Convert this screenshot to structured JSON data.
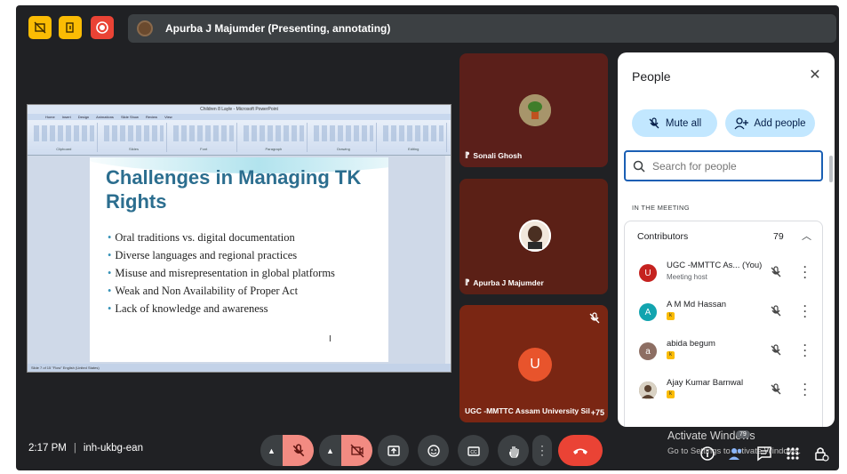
{
  "topbar": {
    "presenter_text": "Apurba J Majumder (Presenting, annotating)",
    "buttons": [
      "no-video-icon",
      "exit-icon",
      "record-icon"
    ]
  },
  "shared_screen": {
    "window_title": "Children 8 Layle - Microsoft PowerPoint",
    "ribbon_tabs": [
      "Home",
      "Insert",
      "Design",
      "Animations",
      "Slide Show",
      "Review",
      "View"
    ],
    "ribbon_groups": [
      "Clipboard",
      "Slides",
      "Font",
      "Paragraph",
      "Drawing",
      "Editing"
    ],
    "status_text": "Slide 7 of 15   \"Flow\"   English (United States)",
    "slide": {
      "title": "Challenges in Managing TK Rights",
      "bullets": [
        "Oral traditions vs. digital documentation",
        "Diverse languages and regional practices",
        "Misuse and misrepresentation in global platforms",
        "Weak and Non Availability of Proper Act",
        "Lack of knowledge and awareness"
      ]
    }
  },
  "tiles": [
    {
      "name": "Sonali Ghosh"
    },
    {
      "name": "Apurba J Majumder"
    },
    {
      "name": "UGC -MMTTC Assam University Sil",
      "initial": "U",
      "more": "+75"
    }
  ],
  "people_panel": {
    "title": "People",
    "mute_all": "Mute all",
    "add_people": "Add people",
    "search_placeholder": "Search for people",
    "section_label": "IN THE MEETING",
    "contributors_label": "Contributors",
    "contributors_count": "79",
    "participants": [
      {
        "initial": "U",
        "name": "UGC -MMTTC As...  (You)",
        "sub": "Meeting host",
        "color": "#c5221f"
      },
      {
        "initial": "A",
        "name": "A M Md Hassan",
        "sub": "",
        "color": "#12a4af"
      },
      {
        "initial": "a",
        "name": "abida begum",
        "sub": "",
        "color": "#8d6e63"
      },
      {
        "initial": "",
        "name": "Ajay Kumar Barnwal",
        "sub": "",
        "color": "#7b6a58"
      }
    ]
  },
  "bottom": {
    "time": "2:17 PM",
    "meeting_code": "inh-ukbg-ean",
    "watermark_title": "Activate Windows",
    "watermark_sub": "Go to Settings to activate Windows.",
    "people_badge": "79"
  },
  "colors": {
    "background": "#202124",
    "end_call": "#ea4335",
    "panel_accent": "#c2e7ff"
  }
}
